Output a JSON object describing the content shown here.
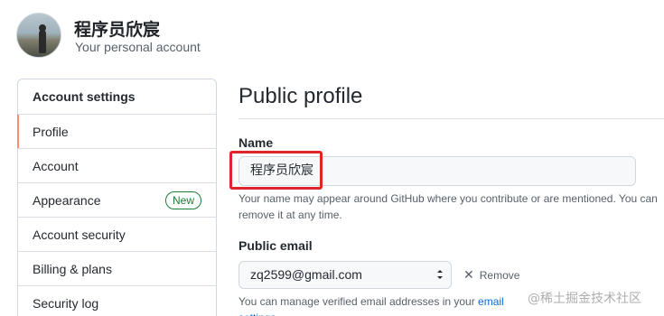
{
  "header": {
    "username": "程序员欣宸",
    "subtitle": "Your personal account"
  },
  "sidebar": {
    "heading": "Account settings",
    "items": [
      {
        "label": "Profile"
      },
      {
        "label": "Account"
      },
      {
        "label": "Appearance",
        "badge": "New"
      },
      {
        "label": "Account security"
      },
      {
        "label": "Billing & plans"
      },
      {
        "label": "Security log"
      }
    ]
  },
  "main": {
    "title": "Public profile",
    "name_label": "Name",
    "name_value": "程序员欣宸",
    "name_note": "Your name may appear around GitHub where you contribute or are mentioned. You can remove it at any time.",
    "email_label": "Public email",
    "email_value": "zq2599@gmail.com",
    "remove_label": "Remove",
    "email_note_prefix": "You can manage verified email addresses in your ",
    "email_note_link": "email settings",
    "email_note_suffix": "."
  },
  "watermark": "@稀土掘金技术社区",
  "colors": {
    "active_indicator": "#fd8c73",
    "badge_green": "#1a7f37",
    "highlight_red": "#e0242a",
    "link_blue": "#0969da"
  }
}
